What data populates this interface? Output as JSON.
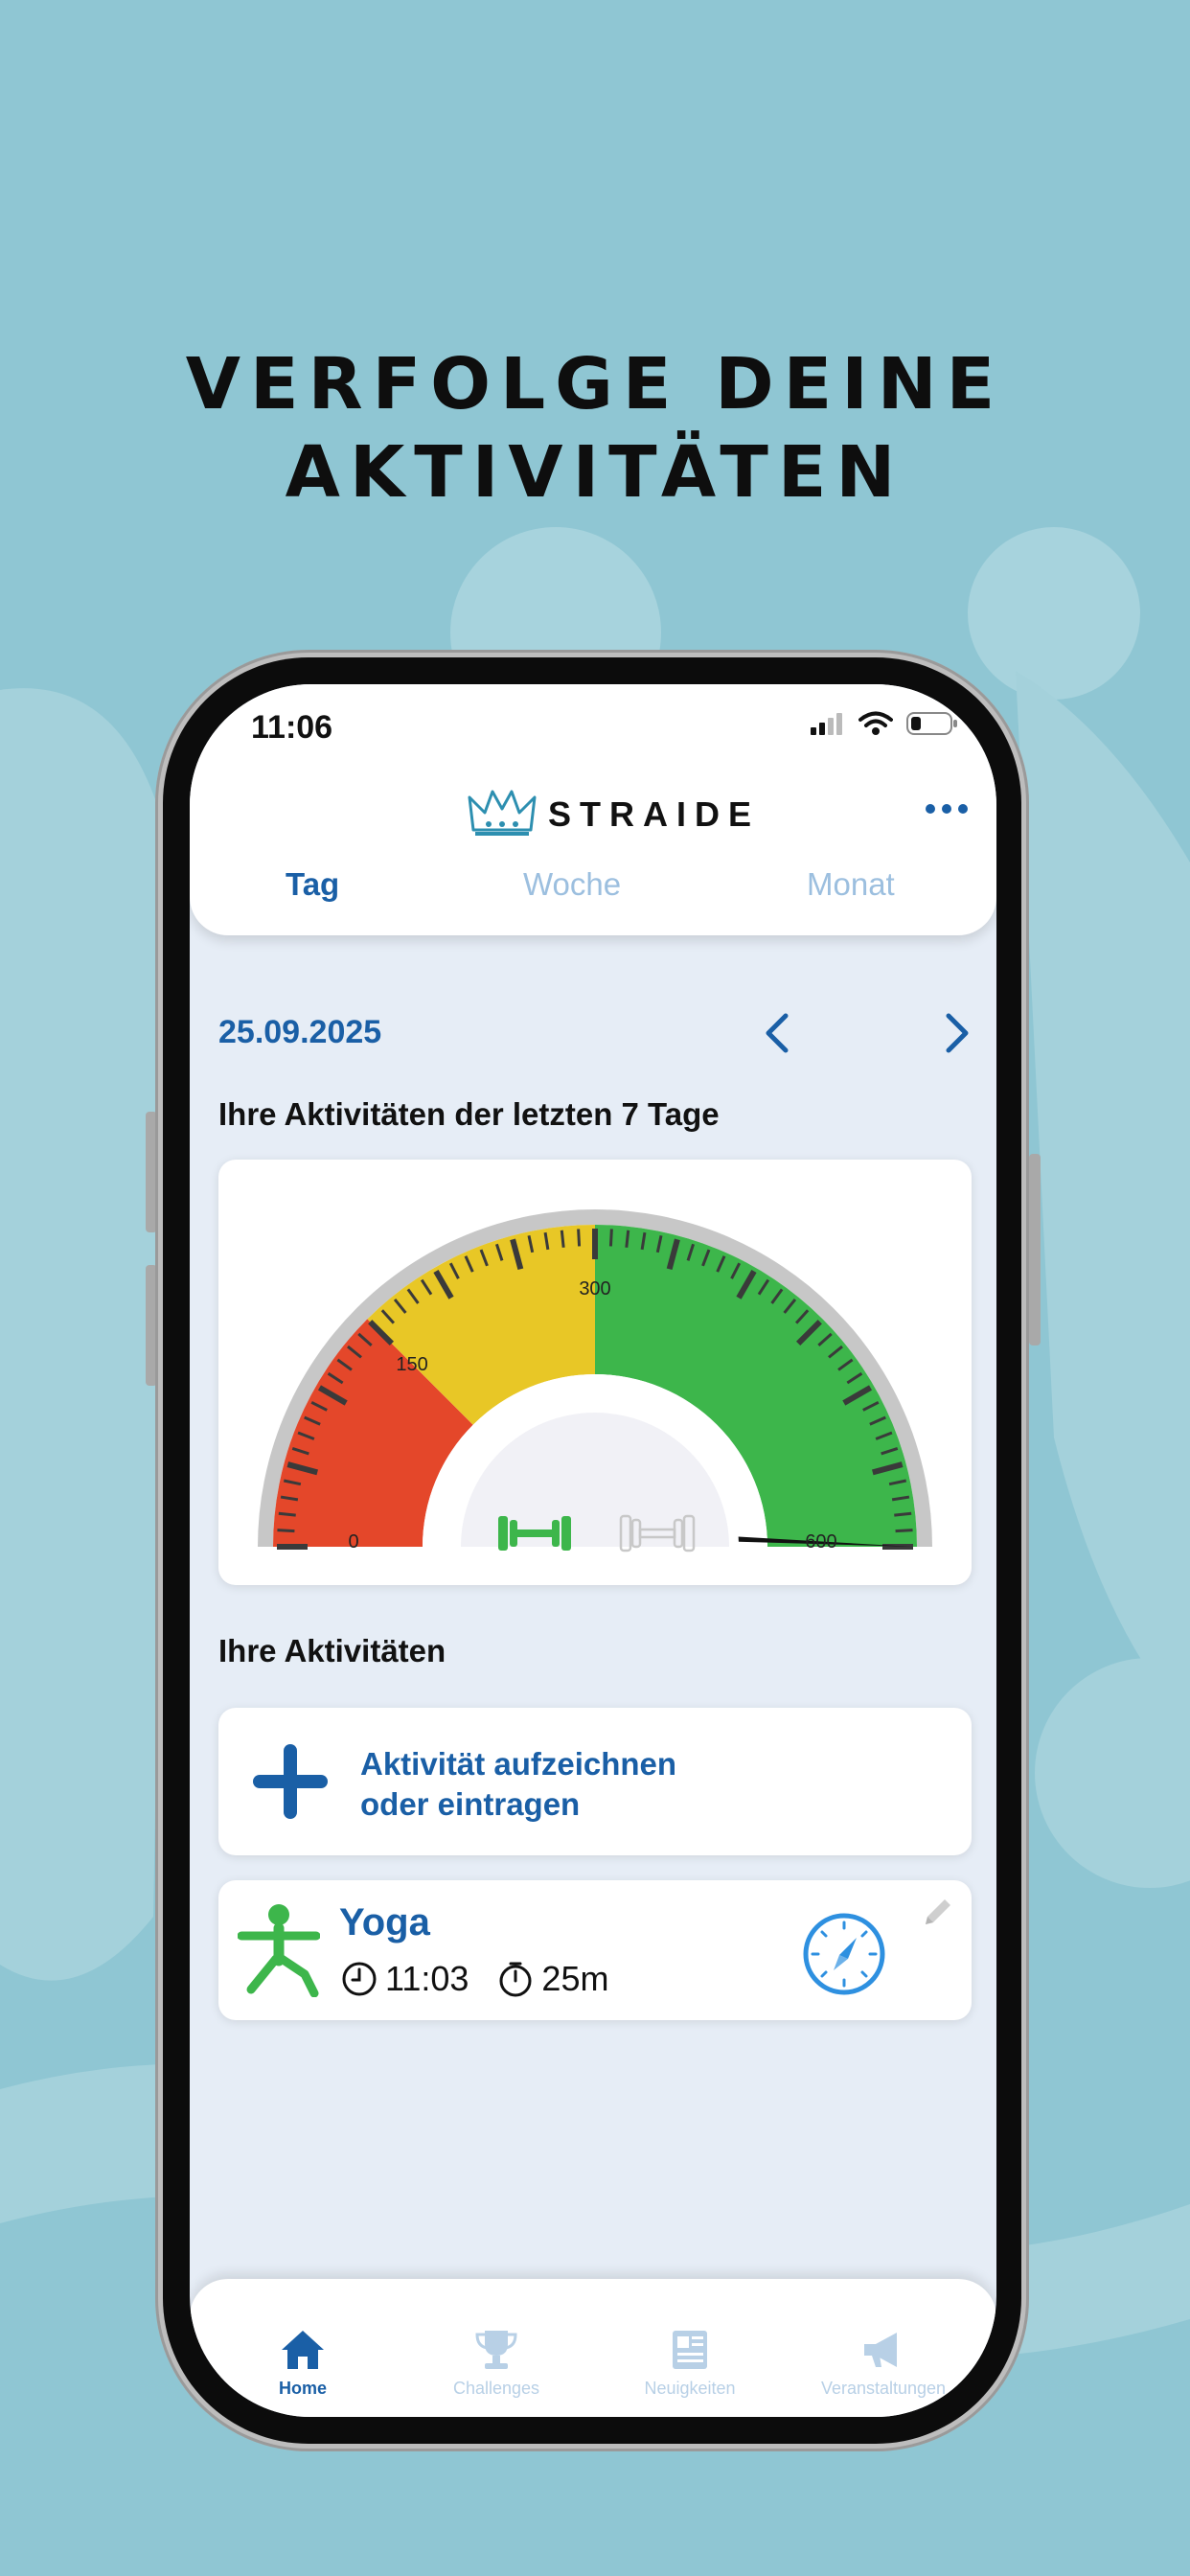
{
  "headline": {
    "line1": "VERFOLGE DEINE",
    "line2": "AKTIVITÄTEN"
  },
  "status_bar": {
    "time": "11:06"
  },
  "header": {
    "logo_text": "STRAIDE",
    "tabs": [
      {
        "label": "Tag",
        "active": true
      },
      {
        "label": "Woche",
        "active": false
      },
      {
        "label": "Monat",
        "active": false
      }
    ]
  },
  "date_nav": {
    "date": "25.09.2025"
  },
  "gauge_section": {
    "title": "Ihre Aktivitäten der letzten 7 Tage",
    "tick_labels": [
      "0",
      "150",
      "300",
      "600"
    ],
    "needle_value": 600,
    "colors": {
      "red": "#e4472a",
      "yellow": "#e8c726",
      "green": "#3db64b"
    }
  },
  "activities_section": {
    "title": "Ihre Aktivitäten",
    "add_line1": "Aktivität aufzeichnen",
    "add_line2": "oder eintragen",
    "items": [
      {
        "name": "Yoga",
        "time": "11:03",
        "duration": "25m",
        "icon": "yoga-figure-icon"
      }
    ]
  },
  "bottom_nav": {
    "items": [
      {
        "label": "Home",
        "icon": "home-icon",
        "active": true
      },
      {
        "label": "Challenges",
        "icon": "trophy-icon",
        "active": false
      },
      {
        "label": "Neuigkeiten",
        "icon": "newspaper-icon",
        "active": false
      },
      {
        "label": "Veranstaltungen",
        "icon": "megaphone-icon",
        "active": false
      }
    ]
  },
  "colors": {
    "primary": "#1a5fa6",
    "background": "#8fc6d3",
    "screen": "#e6edf6"
  }
}
